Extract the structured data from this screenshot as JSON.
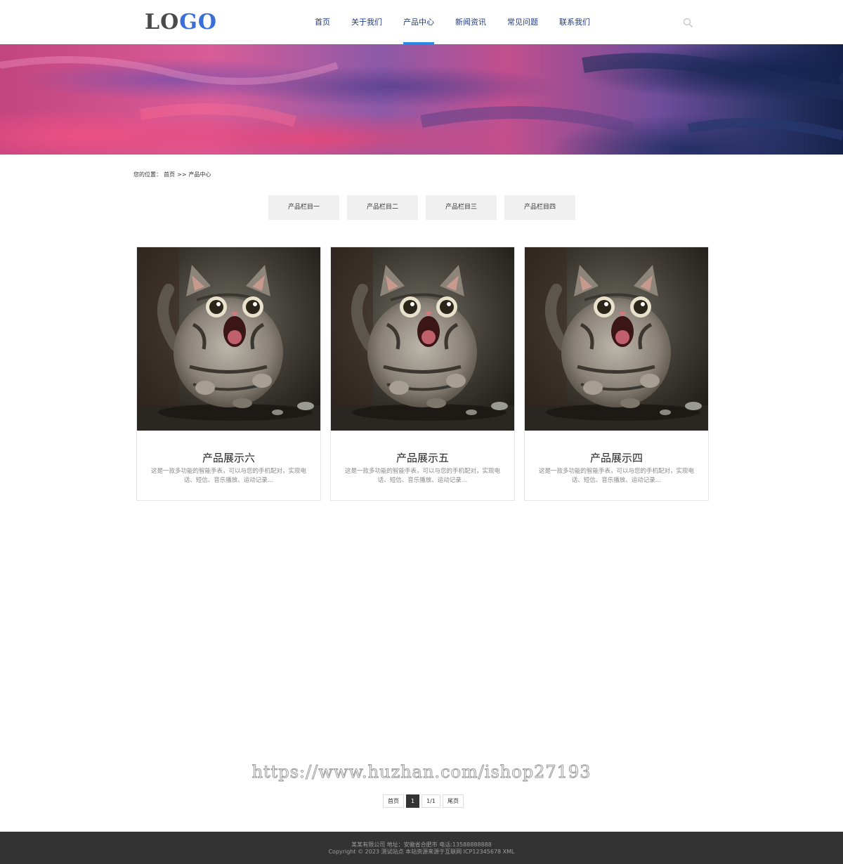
{
  "header": {
    "logo": {
      "part1": "LO",
      "part2": "GO"
    },
    "nav": [
      {
        "label": "首页"
      },
      {
        "label": "关于我们"
      },
      {
        "label": "产品中心",
        "active": true
      },
      {
        "label": "新闻资讯"
      },
      {
        "label": "常见问题"
      },
      {
        "label": "联系我们"
      }
    ],
    "search_icon": "search-icon"
  },
  "breadcrumb": {
    "prefix": "您的位置：",
    "home": "首页",
    "separator": ">>",
    "current": "产品中心"
  },
  "categories": [
    {
      "label": "产品栏目一"
    },
    {
      "label": "产品栏目二"
    },
    {
      "label": "产品栏目三"
    },
    {
      "label": "产品栏目四"
    }
  ],
  "products": [
    {
      "title": "产品展示六",
      "desc": "这是一款多功能的智能手表，可以与您的手机配对，实现电话、短信、音乐播放、运动记录…"
    },
    {
      "title": "产品展示五",
      "desc": "这是一款多功能的智能手表，可以与您的手机配对，实现电话、短信、音乐播放、运动记录…"
    },
    {
      "title": "产品展示四",
      "desc": "这是一款多功能的智能手表，可以与您的手机配对，实现电话、短信、音乐播放、运动记录…"
    }
  ],
  "watermark": "https://www.huzhan.com/ishop27193",
  "pagination": {
    "first": "首页",
    "current": "1",
    "info": "1/1",
    "last": "尾页"
  },
  "footer": {
    "line1": "某某有限公司 地址：安徽省合肥市 电话:13588888888",
    "line2": "Copyright © 2023 测试站点 本站资源来源于互联网 ICP12345678 XML"
  },
  "colors": {
    "nav_text": "#1f3c88",
    "nav_active_underline": "#2a8be6",
    "logo_accent": "#3a6fd8",
    "footer_bg": "#333333"
  }
}
